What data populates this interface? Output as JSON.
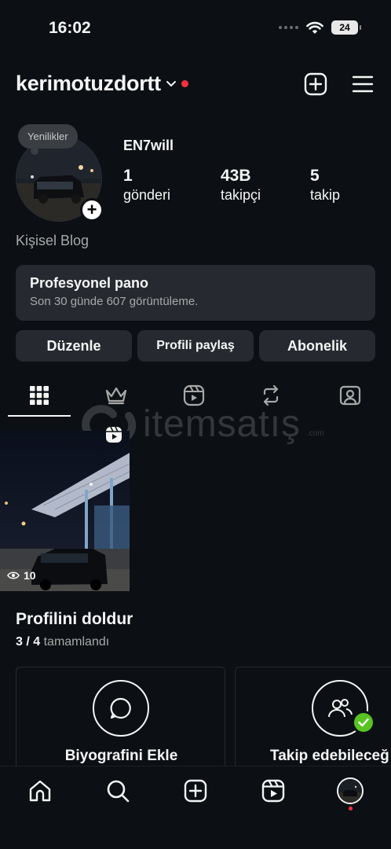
{
  "status_bar": {
    "time": "16:02",
    "battery": "24"
  },
  "header": {
    "username": "kerimotuzdortt"
  },
  "profile": {
    "note": "Yenilikler",
    "display_name": "EN7will",
    "stats": [
      {
        "value": "1",
        "label": "gönderi"
      },
      {
        "value": "43B",
        "label": "takipçi"
      },
      {
        "value": "5",
        "label": "takip"
      }
    ],
    "bio": "Kişisel Blog"
  },
  "dashboard": {
    "title": "Profesyonel pano",
    "subtitle": "Son 30 günde 607 görüntüleme."
  },
  "buttons": {
    "edit": "Düzenle",
    "share": "Profili paylaş",
    "subscribe": "Abonelik"
  },
  "watermark": {
    "text": "itemsatış",
    "sub": ".com"
  },
  "post": {
    "views": "10"
  },
  "complete_profile": {
    "title": "Profilini doldur",
    "progress": "3 / 4",
    "progress_label": "tamamlandı",
    "cards": [
      {
        "label": "Biyografini Ekle",
        "icon": "speech-bubble-icon"
      },
      {
        "label": "Takip edebileceğ",
        "icon": "people-icon"
      }
    ]
  },
  "nav": {
    "items": [
      "home-icon",
      "search-icon",
      "create-icon",
      "reels-icon",
      "profile-avatar"
    ]
  },
  "colors": {
    "background": "#0c1014",
    "surface": "#262a30",
    "notification": "#ff3040",
    "check": "#58c322"
  }
}
